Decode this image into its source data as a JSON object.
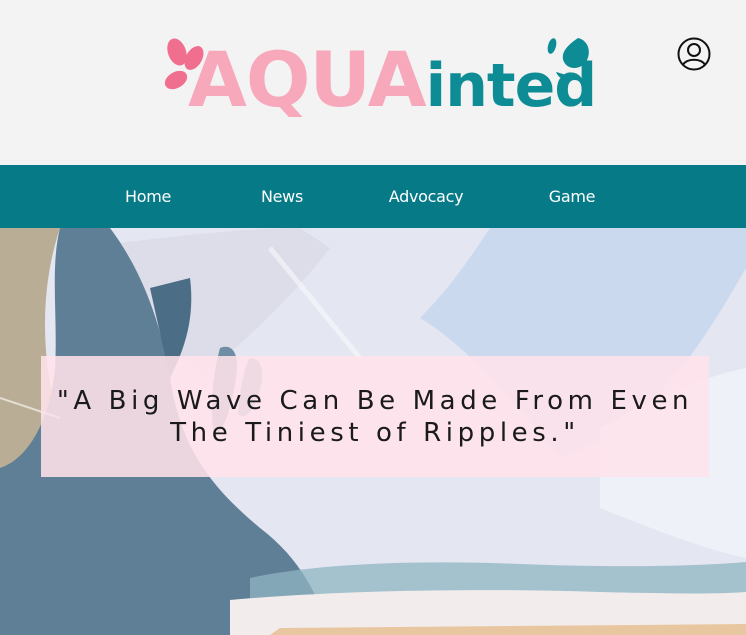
{
  "brand": {
    "logo_part1": "AQUA",
    "logo_part2": "inted",
    "colors": {
      "pink": "#f7a8bb",
      "teal": "#0e8c96"
    }
  },
  "header": {
    "account_icon": "user-circle-icon"
  },
  "nav": {
    "background": "#067b87",
    "items": [
      {
        "label": "Home"
      },
      {
        "label": "News"
      },
      {
        "label": "Advocacy"
      },
      {
        "label": "Game"
      }
    ]
  },
  "hero": {
    "quote": "\"A Big Wave Can Be Made From Even The Tiniest of Ripples.\""
  }
}
